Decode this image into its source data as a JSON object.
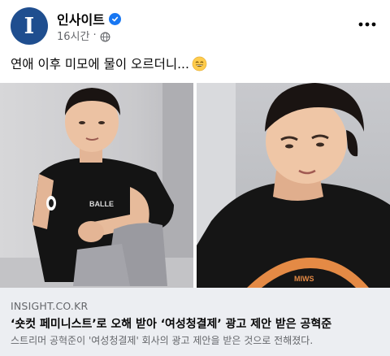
{
  "post": {
    "page_name": "인사이트",
    "avatar_letter": "I",
    "timestamp": "16시간",
    "separator": "·",
    "audience_icon": "globe-icon",
    "verified_icon": "verified-badge-icon",
    "more_icon": "more-dots-icon",
    "text": "연애 이후 미모에 물이 오르더니...",
    "emoji": "grinning-face-emoji"
  },
  "media": {
    "photos": [
      {
        "name": "photo-sitting",
        "shirt_text": "BALLE"
      },
      {
        "name": "photo-closeup",
        "shirt_text": "MIWS"
      }
    ]
  },
  "link_card": {
    "domain": "INSIGHT.CO.KR",
    "title": "‘숏컷 페미니스트’로 오해 받아 ‘여성청결제’ 광고 제안 받은 공혁준",
    "description": "스트리머 공혁준이 '여성청결제' 회사의 광고 제안을 받은 것으로 전해졌다."
  },
  "colors": {
    "brand_avatar": "#1f4e8f",
    "verified": "#1877f2",
    "secondary_text": "#65676b",
    "card_background": "#eceef2"
  }
}
